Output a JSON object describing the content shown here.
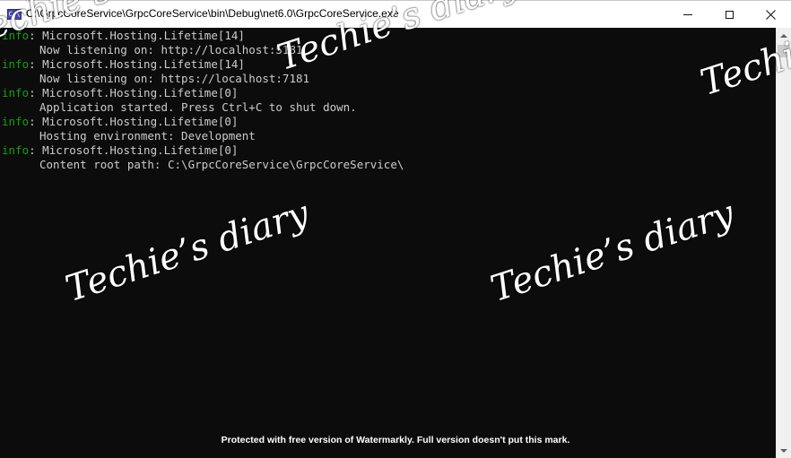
{
  "window": {
    "title": "C:\\GrpcCoreService\\GrpcCoreService\\bin\\Debug\\net6.0\\GrpcCoreService.exe",
    "app_icon_label": "C:\\",
    "controls": {
      "minimize_icon": "minimize-icon",
      "maximize_icon": "maximize-icon",
      "close_icon": "close-icon",
      "close_glyph": "✕"
    }
  },
  "console": {
    "level_color": "#13a10e",
    "text_color": "#cccccc",
    "lines": [
      {
        "level": "info",
        "text": "Microsoft.Hosting.Lifetime[14]"
      },
      {
        "level": "",
        "text": "Now listening on: http://localhost:5181"
      },
      {
        "level": "info",
        "text": "Microsoft.Hosting.Lifetime[14]"
      },
      {
        "level": "",
        "text": "Now listening on: https://localhost:7181"
      },
      {
        "level": "info",
        "text": "Microsoft.Hosting.Lifetime[0]"
      },
      {
        "level": "",
        "text": "Application started. Press Ctrl+C to shut down."
      },
      {
        "level": "info",
        "text": "Microsoft.Hosting.Lifetime[0]"
      },
      {
        "level": "",
        "text": "Hosting environment: Development"
      },
      {
        "level": "info",
        "text": "Microsoft.Hosting.Lifetime[0]"
      },
      {
        "level": "",
        "text": "Content root path: C:\\GrpcCoreService\\GrpcCoreService\\"
      }
    ]
  },
  "scrollbar": {
    "up_icon": "scroll-up-arrow-icon",
    "down_icon": "scroll-down-arrow-icon"
  },
  "watermark": {
    "text": "Techie’s diary",
    "footer": "Protected with free version of Watermarkly. Full version doesn't put this mark."
  }
}
